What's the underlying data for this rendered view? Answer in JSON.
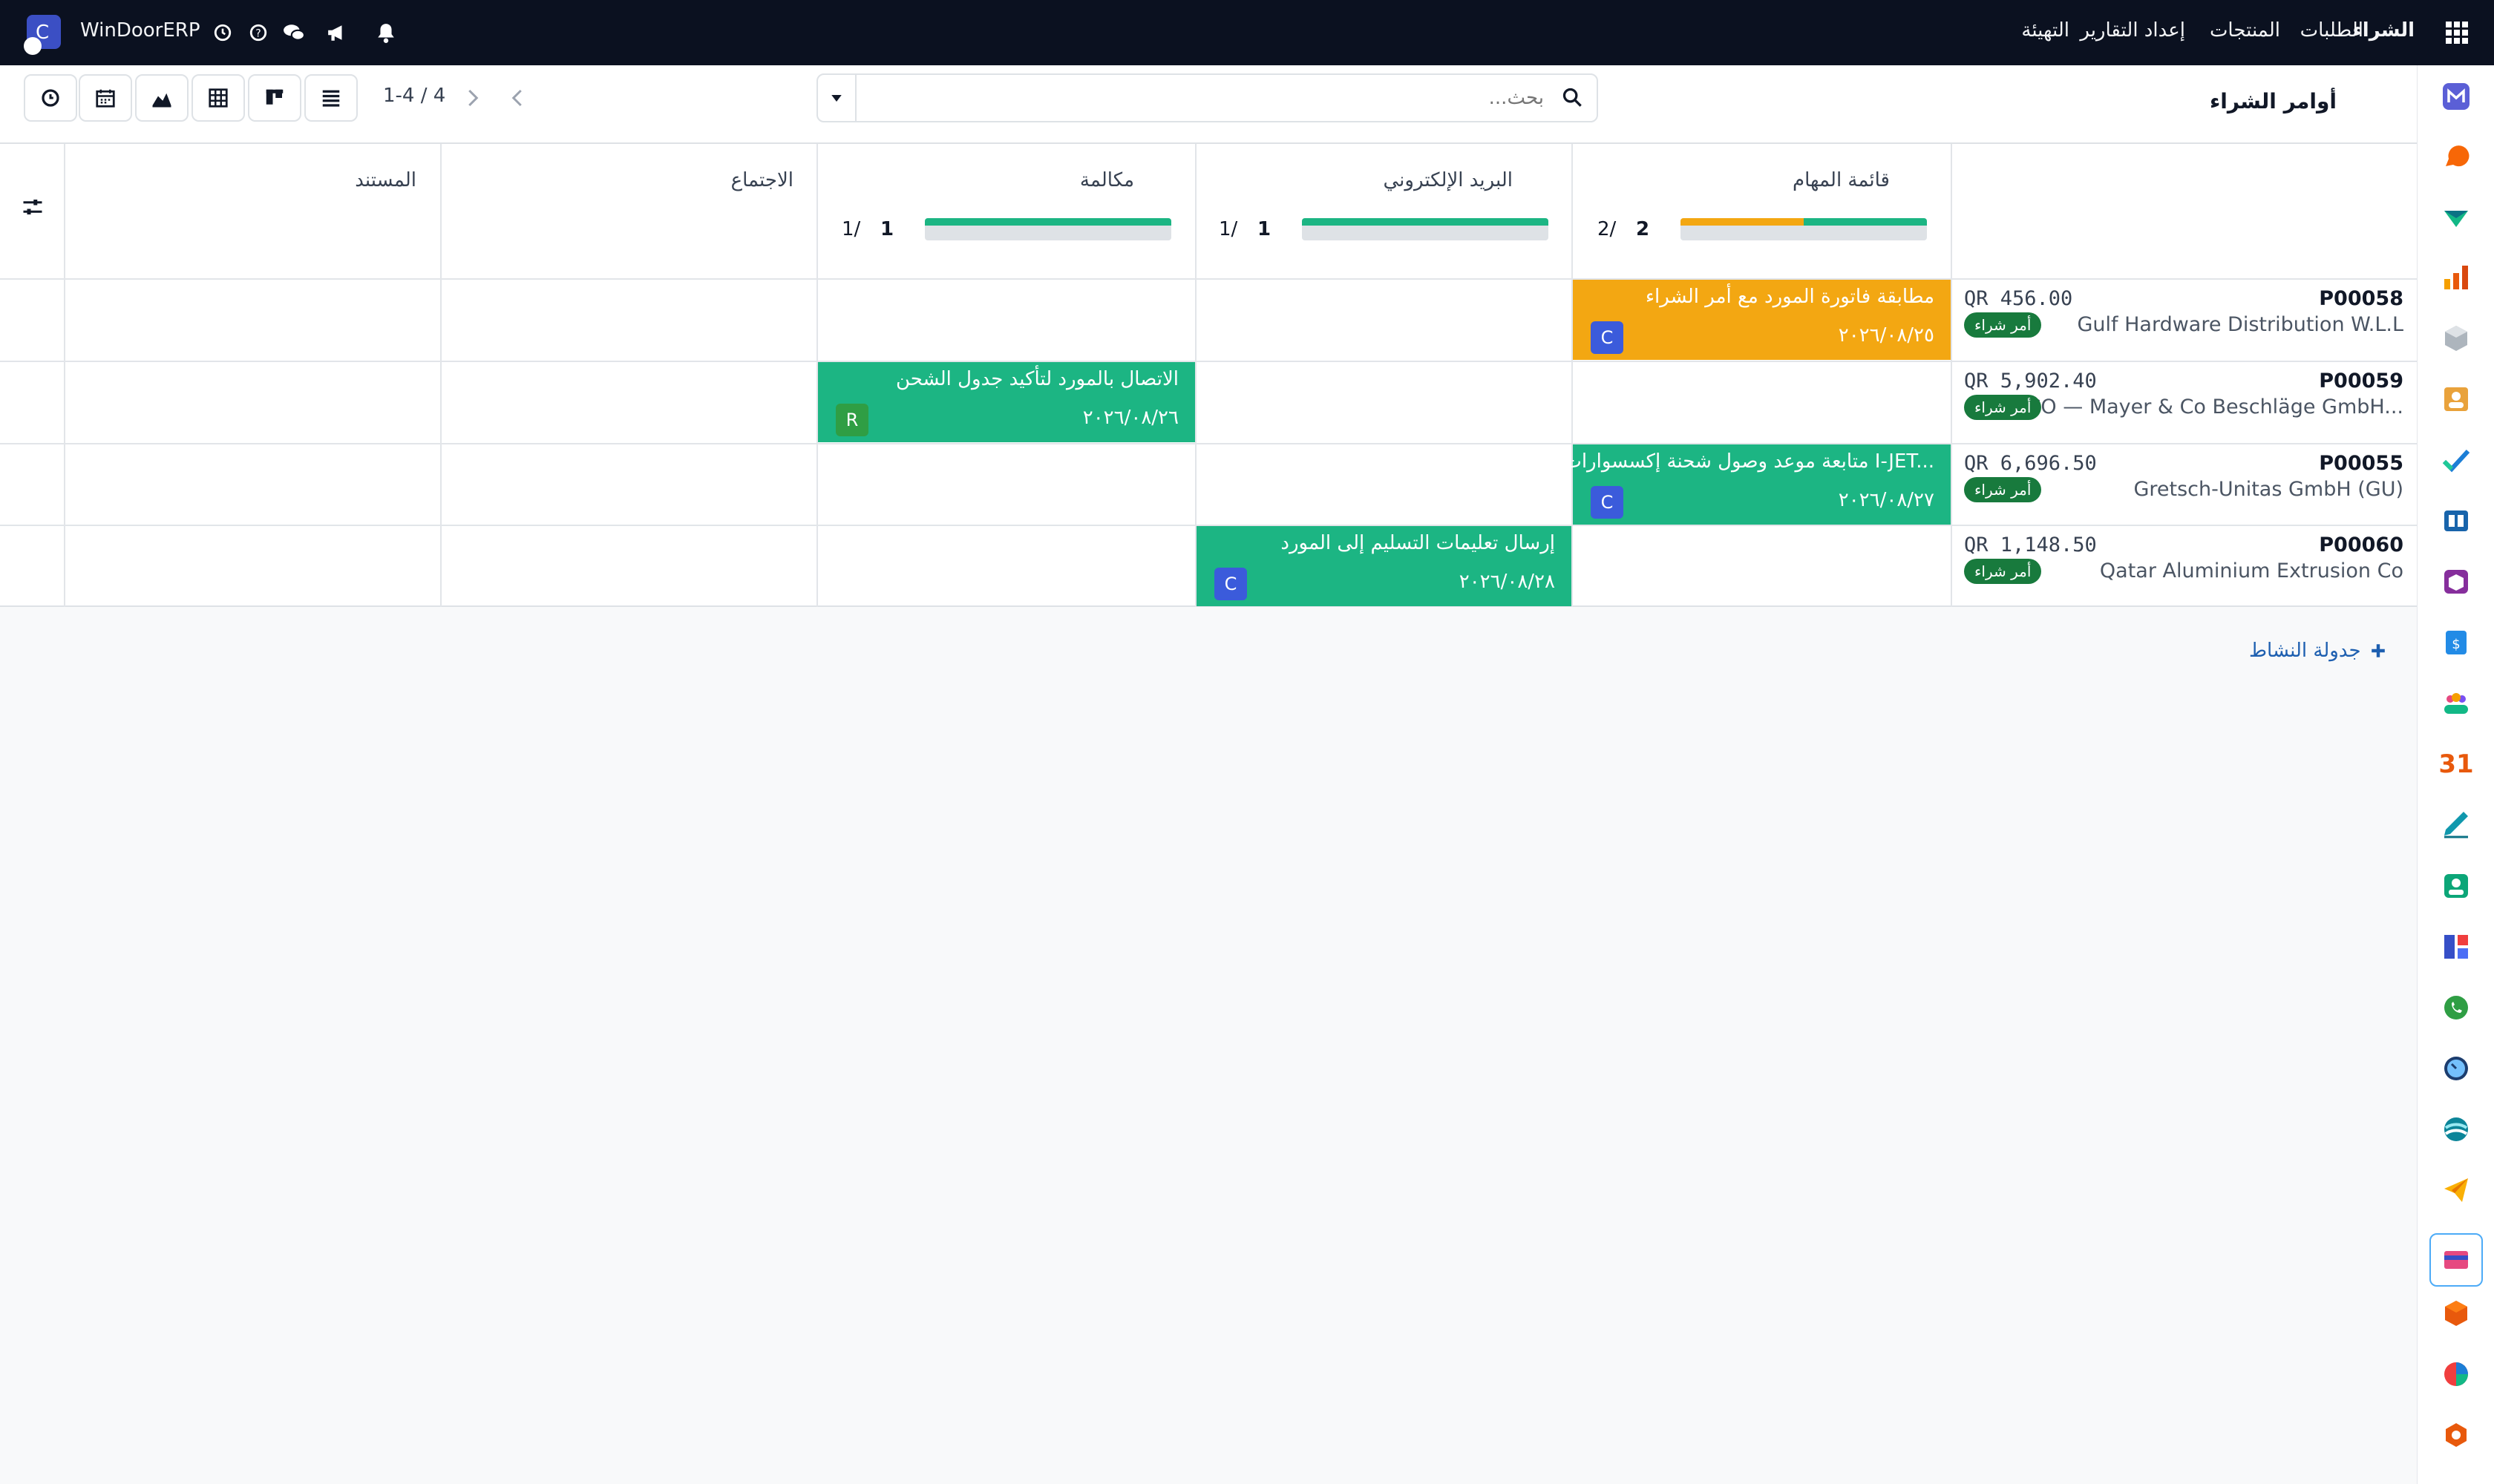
{
  "navbar": {
    "menu": [
      "الشراء",
      "الطلبات",
      "المنتجات",
      "إعداد التقارير",
      "التهيئة"
    ],
    "company": "WinDoorERP",
    "avatar_letter": "C",
    "brand_color": "#0b1120"
  },
  "panel": {
    "title": "أوامر الشراء",
    "search_placeholder": "بحث...",
    "pager": "1-4 / 4",
    "views": [
      "list",
      "kanban",
      "pivot",
      "graph",
      "calendar",
      "activity"
    ]
  },
  "columns": [
    {
      "label": "قائمة المهام",
      "count": "2",
      "total": "2/",
      "progress": {
        "overdue": 0.5,
        "planned": 0.5
      },
      "colors": {
        "overdue": "#f3a712",
        "planned": "#1cb583"
      }
    },
    {
      "label": "البريد الإلكتروني",
      "count": "1",
      "total": "1/",
      "progress": {
        "planned": 1.0
      },
      "colors": {
        "planned": "#1cb583"
      }
    },
    {
      "label": "مكالمة",
      "count": "1",
      "total": "1/",
      "progress": {
        "planned": 1.0
      },
      "colors": {
        "planned": "#1cb583"
      }
    },
    {
      "label": "الاجتماع"
    },
    {
      "label": "المستند"
    }
  ],
  "records": [
    {
      "ref": "P00058",
      "vendor": "Gulf Hardware Distribution W.L.L",
      "amount": "QR 456.00",
      "state": "أمر شراء"
    },
    {
      "ref": "P00059",
      "vendor": "CO — Mayer & Co Beschläge GmbH...",
      "amount": "QR 5,902.40",
      "state": "أمر شراء"
    },
    {
      "ref": "P00055",
      "vendor": "Gretsch-Unitas GmbH (GU)",
      "amount": "QR 6,696.50",
      "state": "أمر شراء"
    },
    {
      "ref": "P00060",
      "vendor": "Qatar Aluminium Extrusion Co",
      "amount": "QR 1,148.50",
      "state": "أمر شراء"
    }
  ],
  "activities": [
    {
      "title": "مطابقة فاتورة المورد مع أمر الشراء",
      "date": "٢٠٢٦/٠٨/٢٥",
      "user": "C",
      "status": "overdue",
      "color": "#f3a712",
      "avatar_color": "#3b5bdb"
    },
    {
      "title": "الاتصال بالمورد لتأكيد جدول الشحن",
      "date": "٢٠٢٦/٠٨/٢٦",
      "user": "R",
      "status": "planned",
      "color": "#1cb583",
      "avatar_color": "#2f9e44"
    },
    {
      "title": "متابعة موعد وصول شحنة إكسسوارات I-JET...",
      "date": "٢٠٢٦/٠٨/٢٧",
      "user": "C",
      "status": "planned",
      "color": "#1cb583",
      "avatar_color": "#3b5bdb"
    },
    {
      "title": "إرسال تعليمات التسليم إلى المورد",
      "date": "٢٠٢٦/٠٨/٢٨",
      "user": "C",
      "status": "planned",
      "color": "#1cb583",
      "avatar_color": "#3b5bdb"
    }
  ],
  "footer": {
    "schedule_label": "جدولة النشاط"
  },
  "rail_apps": [
    "mail-app",
    "discuss-app",
    "vendor-app",
    "reporting-app",
    "inventory-app",
    "contacts-app",
    "tasks-app",
    "library-app",
    "packages-app",
    "invoicing-app",
    "team-app",
    "calendar-app",
    "sign-app",
    "employees-app",
    "dashboard-app",
    "whatsapp-app",
    "clock-app",
    "surveys-app",
    "telegram-app",
    "cards-app",
    "modules-app",
    "chart-app",
    "settings-app"
  ],
  "calendar_icon_text": "31"
}
